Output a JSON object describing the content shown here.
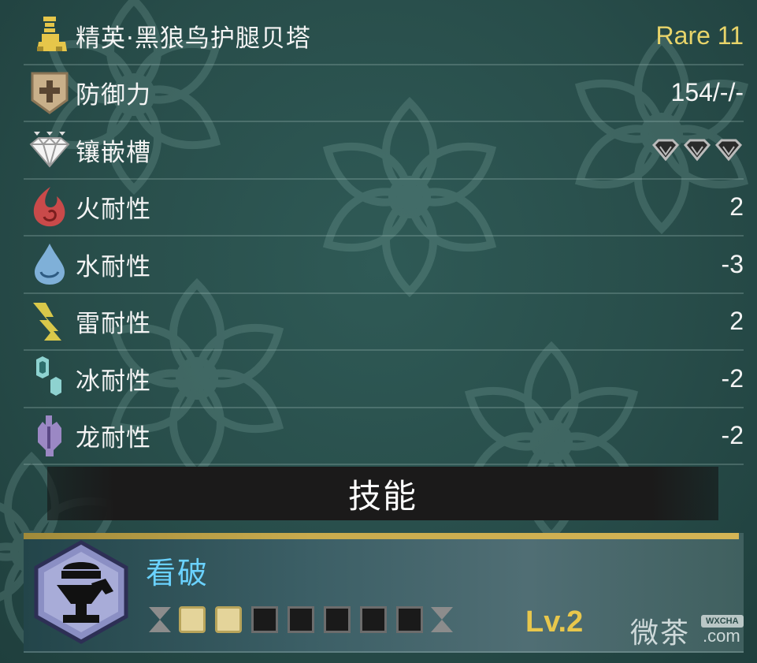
{
  "armor": {
    "name": "精英·黑狼鸟护腿贝塔",
    "rarity": "Rare 11",
    "defense_label": "防御力",
    "defense_value": "154/-/-",
    "slots_label": "镶嵌槽",
    "fire_label": "火耐性",
    "fire_value": "2",
    "water_label": "水耐性",
    "water_value": "-3",
    "thunder_label": "雷耐性",
    "thunder_value": "2",
    "ice_label": "冰耐性",
    "ice_value": "-2",
    "dragon_label": "龙耐性",
    "dragon_value": "-2"
  },
  "skills": {
    "header": "技能",
    "items": [
      {
        "name": "看破",
        "level_text": "Lv.2",
        "level": 2,
        "max_level": 7
      }
    ]
  },
  "colors": {
    "rarity": "#e8d46a",
    "skill_name": "#6ad2ff",
    "level": "#e8c74c",
    "background": "#2f5a56"
  },
  "icons": {
    "armor": "legs-armor-icon",
    "defense": "shield-icon",
    "slots": "gem-icon",
    "fire": "fire-icon",
    "water": "water-drop-icon",
    "thunder": "thunder-icon",
    "ice": "ice-icon",
    "dragon": "dragon-icon",
    "skill": "critical-eye-icon"
  },
  "watermark": {
    "cn": "微茶",
    "badge": "WXCHA",
    "en": ".com"
  }
}
